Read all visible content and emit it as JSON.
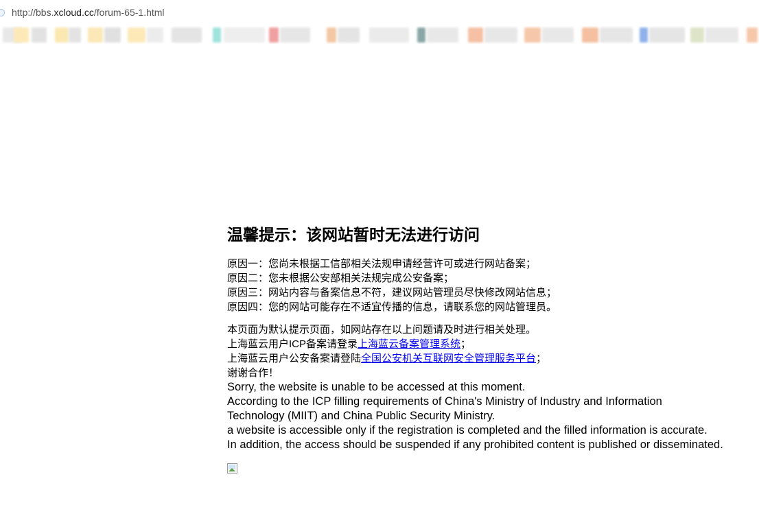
{
  "browser": {
    "url_prefix": "http://bbs.",
    "url_host": "xcloud.cc",
    "url_path": "/forum-65-1.html"
  },
  "notice": {
    "heading": "温馨提示：该网站暂时无法进行访问",
    "reasons": [
      "原因一：您尚未根据工信部相关法规申请经营许可或进行网站备案；",
      "原因二：您未根据公安部相关法规完成公安备案；",
      "原因三：网站内容与备案信息不符，建议网站管理员尽快修改网站信息；",
      "原因四：您的网站可能存在不适宜传播的信息，请联系您的网站管理员。"
    ],
    "default_page_note": "本页面为默认提示页面，如网站存在以上问题请及时进行相关处理。",
    "icp_prefix": "上海蓝云用户ICP备案请登录",
    "icp_link": "上海蓝云备案管理系统",
    "icp_suffix": "；",
    "police_prefix": "上海蓝云用户公安备案请登陆",
    "police_link": "全国公安机关互联网安全管理服务平台",
    "police_suffix": "；",
    "thanks": "谢谢合作！",
    "english": [
      "Sorry, the website is unable to be accessed at this moment.",
      "According to the ICP filling requirements of China's Ministry of Industry and Information",
      "Technology (MIIT) and China Public Security Ministry.",
      "a website is accessible only if the registration is completed and the filled information is accurate.",
      "In addition, the access should be suspended if any prohibited content is published or disseminated."
    ]
  },
  "colors": {
    "link": "#0000ee",
    "text": "#000000",
    "background": "#ffffff"
  }
}
